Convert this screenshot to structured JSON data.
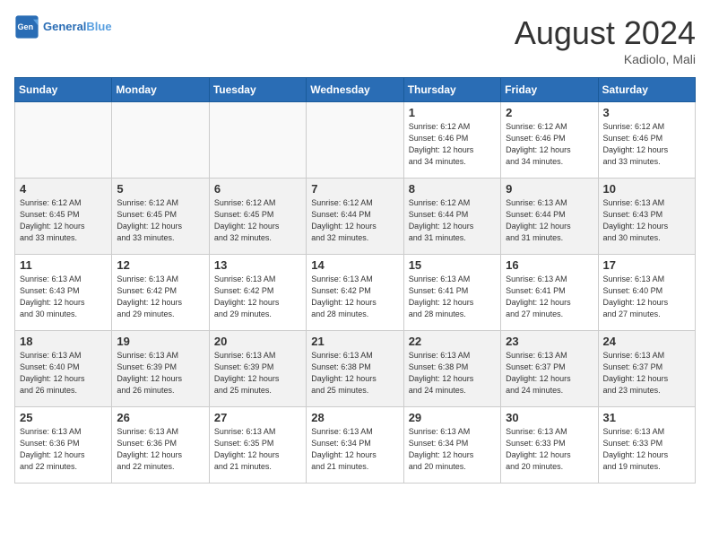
{
  "header": {
    "logo_general": "General",
    "logo_blue": "Blue",
    "month_year": "August 2024",
    "location": "Kadiolo, Mali"
  },
  "days_of_week": [
    "Sunday",
    "Monday",
    "Tuesday",
    "Wednesday",
    "Thursday",
    "Friday",
    "Saturday"
  ],
  "weeks": [
    [
      {
        "day": "",
        "info": ""
      },
      {
        "day": "",
        "info": ""
      },
      {
        "day": "",
        "info": ""
      },
      {
        "day": "",
        "info": ""
      },
      {
        "day": "1",
        "info": "Sunrise: 6:12 AM\nSunset: 6:46 PM\nDaylight: 12 hours\nand 34 minutes."
      },
      {
        "day": "2",
        "info": "Sunrise: 6:12 AM\nSunset: 6:46 PM\nDaylight: 12 hours\nand 34 minutes."
      },
      {
        "day": "3",
        "info": "Sunrise: 6:12 AM\nSunset: 6:46 PM\nDaylight: 12 hours\nand 33 minutes."
      }
    ],
    [
      {
        "day": "4",
        "info": "Sunrise: 6:12 AM\nSunset: 6:45 PM\nDaylight: 12 hours\nand 33 minutes."
      },
      {
        "day": "5",
        "info": "Sunrise: 6:12 AM\nSunset: 6:45 PM\nDaylight: 12 hours\nand 33 minutes."
      },
      {
        "day": "6",
        "info": "Sunrise: 6:12 AM\nSunset: 6:45 PM\nDaylight: 12 hours\nand 32 minutes."
      },
      {
        "day": "7",
        "info": "Sunrise: 6:12 AM\nSunset: 6:44 PM\nDaylight: 12 hours\nand 32 minutes."
      },
      {
        "day": "8",
        "info": "Sunrise: 6:12 AM\nSunset: 6:44 PM\nDaylight: 12 hours\nand 31 minutes."
      },
      {
        "day": "9",
        "info": "Sunrise: 6:13 AM\nSunset: 6:44 PM\nDaylight: 12 hours\nand 31 minutes."
      },
      {
        "day": "10",
        "info": "Sunrise: 6:13 AM\nSunset: 6:43 PM\nDaylight: 12 hours\nand 30 minutes."
      }
    ],
    [
      {
        "day": "11",
        "info": "Sunrise: 6:13 AM\nSunset: 6:43 PM\nDaylight: 12 hours\nand 30 minutes."
      },
      {
        "day": "12",
        "info": "Sunrise: 6:13 AM\nSunset: 6:42 PM\nDaylight: 12 hours\nand 29 minutes."
      },
      {
        "day": "13",
        "info": "Sunrise: 6:13 AM\nSunset: 6:42 PM\nDaylight: 12 hours\nand 29 minutes."
      },
      {
        "day": "14",
        "info": "Sunrise: 6:13 AM\nSunset: 6:42 PM\nDaylight: 12 hours\nand 28 minutes."
      },
      {
        "day": "15",
        "info": "Sunrise: 6:13 AM\nSunset: 6:41 PM\nDaylight: 12 hours\nand 28 minutes."
      },
      {
        "day": "16",
        "info": "Sunrise: 6:13 AM\nSunset: 6:41 PM\nDaylight: 12 hours\nand 27 minutes."
      },
      {
        "day": "17",
        "info": "Sunrise: 6:13 AM\nSunset: 6:40 PM\nDaylight: 12 hours\nand 27 minutes."
      }
    ],
    [
      {
        "day": "18",
        "info": "Sunrise: 6:13 AM\nSunset: 6:40 PM\nDaylight: 12 hours\nand 26 minutes."
      },
      {
        "day": "19",
        "info": "Sunrise: 6:13 AM\nSunset: 6:39 PM\nDaylight: 12 hours\nand 26 minutes."
      },
      {
        "day": "20",
        "info": "Sunrise: 6:13 AM\nSunset: 6:39 PM\nDaylight: 12 hours\nand 25 minutes."
      },
      {
        "day": "21",
        "info": "Sunrise: 6:13 AM\nSunset: 6:38 PM\nDaylight: 12 hours\nand 25 minutes."
      },
      {
        "day": "22",
        "info": "Sunrise: 6:13 AM\nSunset: 6:38 PM\nDaylight: 12 hours\nand 24 minutes."
      },
      {
        "day": "23",
        "info": "Sunrise: 6:13 AM\nSunset: 6:37 PM\nDaylight: 12 hours\nand 24 minutes."
      },
      {
        "day": "24",
        "info": "Sunrise: 6:13 AM\nSunset: 6:37 PM\nDaylight: 12 hours\nand 23 minutes."
      }
    ],
    [
      {
        "day": "25",
        "info": "Sunrise: 6:13 AM\nSunset: 6:36 PM\nDaylight: 12 hours\nand 22 minutes."
      },
      {
        "day": "26",
        "info": "Sunrise: 6:13 AM\nSunset: 6:36 PM\nDaylight: 12 hours\nand 22 minutes."
      },
      {
        "day": "27",
        "info": "Sunrise: 6:13 AM\nSunset: 6:35 PM\nDaylight: 12 hours\nand 21 minutes."
      },
      {
        "day": "28",
        "info": "Sunrise: 6:13 AM\nSunset: 6:34 PM\nDaylight: 12 hours\nand 21 minutes."
      },
      {
        "day": "29",
        "info": "Sunrise: 6:13 AM\nSunset: 6:34 PM\nDaylight: 12 hours\nand 20 minutes."
      },
      {
        "day": "30",
        "info": "Sunrise: 6:13 AM\nSunset: 6:33 PM\nDaylight: 12 hours\nand 20 minutes."
      },
      {
        "day": "31",
        "info": "Sunrise: 6:13 AM\nSunset: 6:33 PM\nDaylight: 12 hours\nand 19 minutes."
      }
    ]
  ]
}
